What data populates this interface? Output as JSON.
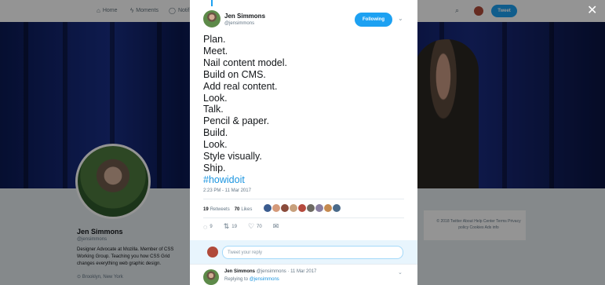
{
  "nav": {
    "items": [
      {
        "icon": "home-icon",
        "glyph": "⌂",
        "label": "Home"
      },
      {
        "icon": "moments-icon",
        "glyph": "ϟ",
        "label": "Moments"
      },
      {
        "icon": "notifications-icon",
        "glyph": "◯",
        "label": "Notif"
      }
    ],
    "tweet_button": "Tweet"
  },
  "profile": {
    "name": "Jen Simmons",
    "handle": "@jensimmons",
    "bio": "Designer Advocate at Mozilla. Member of CSS Working Group. Teaching you how CSS Grid changes everything web graphic design.",
    "location": "Brooklyn, New York"
  },
  "footer": {
    "links": "© 2018 Twitter  About  Help Center  Terms  Privacy policy  Cookies  Ads info"
  },
  "tweet": {
    "author_name": "Jen Simmons",
    "author_handle": "@jensimmons",
    "follow_label": "Following",
    "lines": [
      "Plan.",
      "Meet.",
      "Nail content model.",
      "Build on CMS.",
      "Add real content.",
      "Look.",
      "Talk.",
      "Pencil & paper.",
      "Build.",
      "Look.",
      "Style visually.",
      "Ship."
    ],
    "hashtag": "#howidoit",
    "timestamp": "2:23 PM - 11 Mar 2017",
    "retweets_count": "19",
    "retweets_label": "Retweets",
    "likes_count": "70",
    "likes_label": "Likes",
    "liker_colors": [
      "#3b5c8f",
      "#d59a7a",
      "#8a4b3b",
      "#c7a07c",
      "#b54a3d",
      "#6d6a62",
      "#8a7fa1",
      "#c58a50",
      "#4a6a8a"
    ],
    "reply_count": "9",
    "retweet_action_count": "19",
    "like_action_count": "70"
  },
  "reply_box": {
    "placeholder": "Tweet your reply"
  },
  "reply_tweet": {
    "author_name": "Jen Simmons",
    "author_handle": "@jensimmons",
    "date": "11 Mar 2017",
    "replying_prefix": "Replying to",
    "replying_to": "@jensimmons"
  },
  "colors": {
    "accent": "#1da1f2",
    "link": "#1b95e0"
  }
}
